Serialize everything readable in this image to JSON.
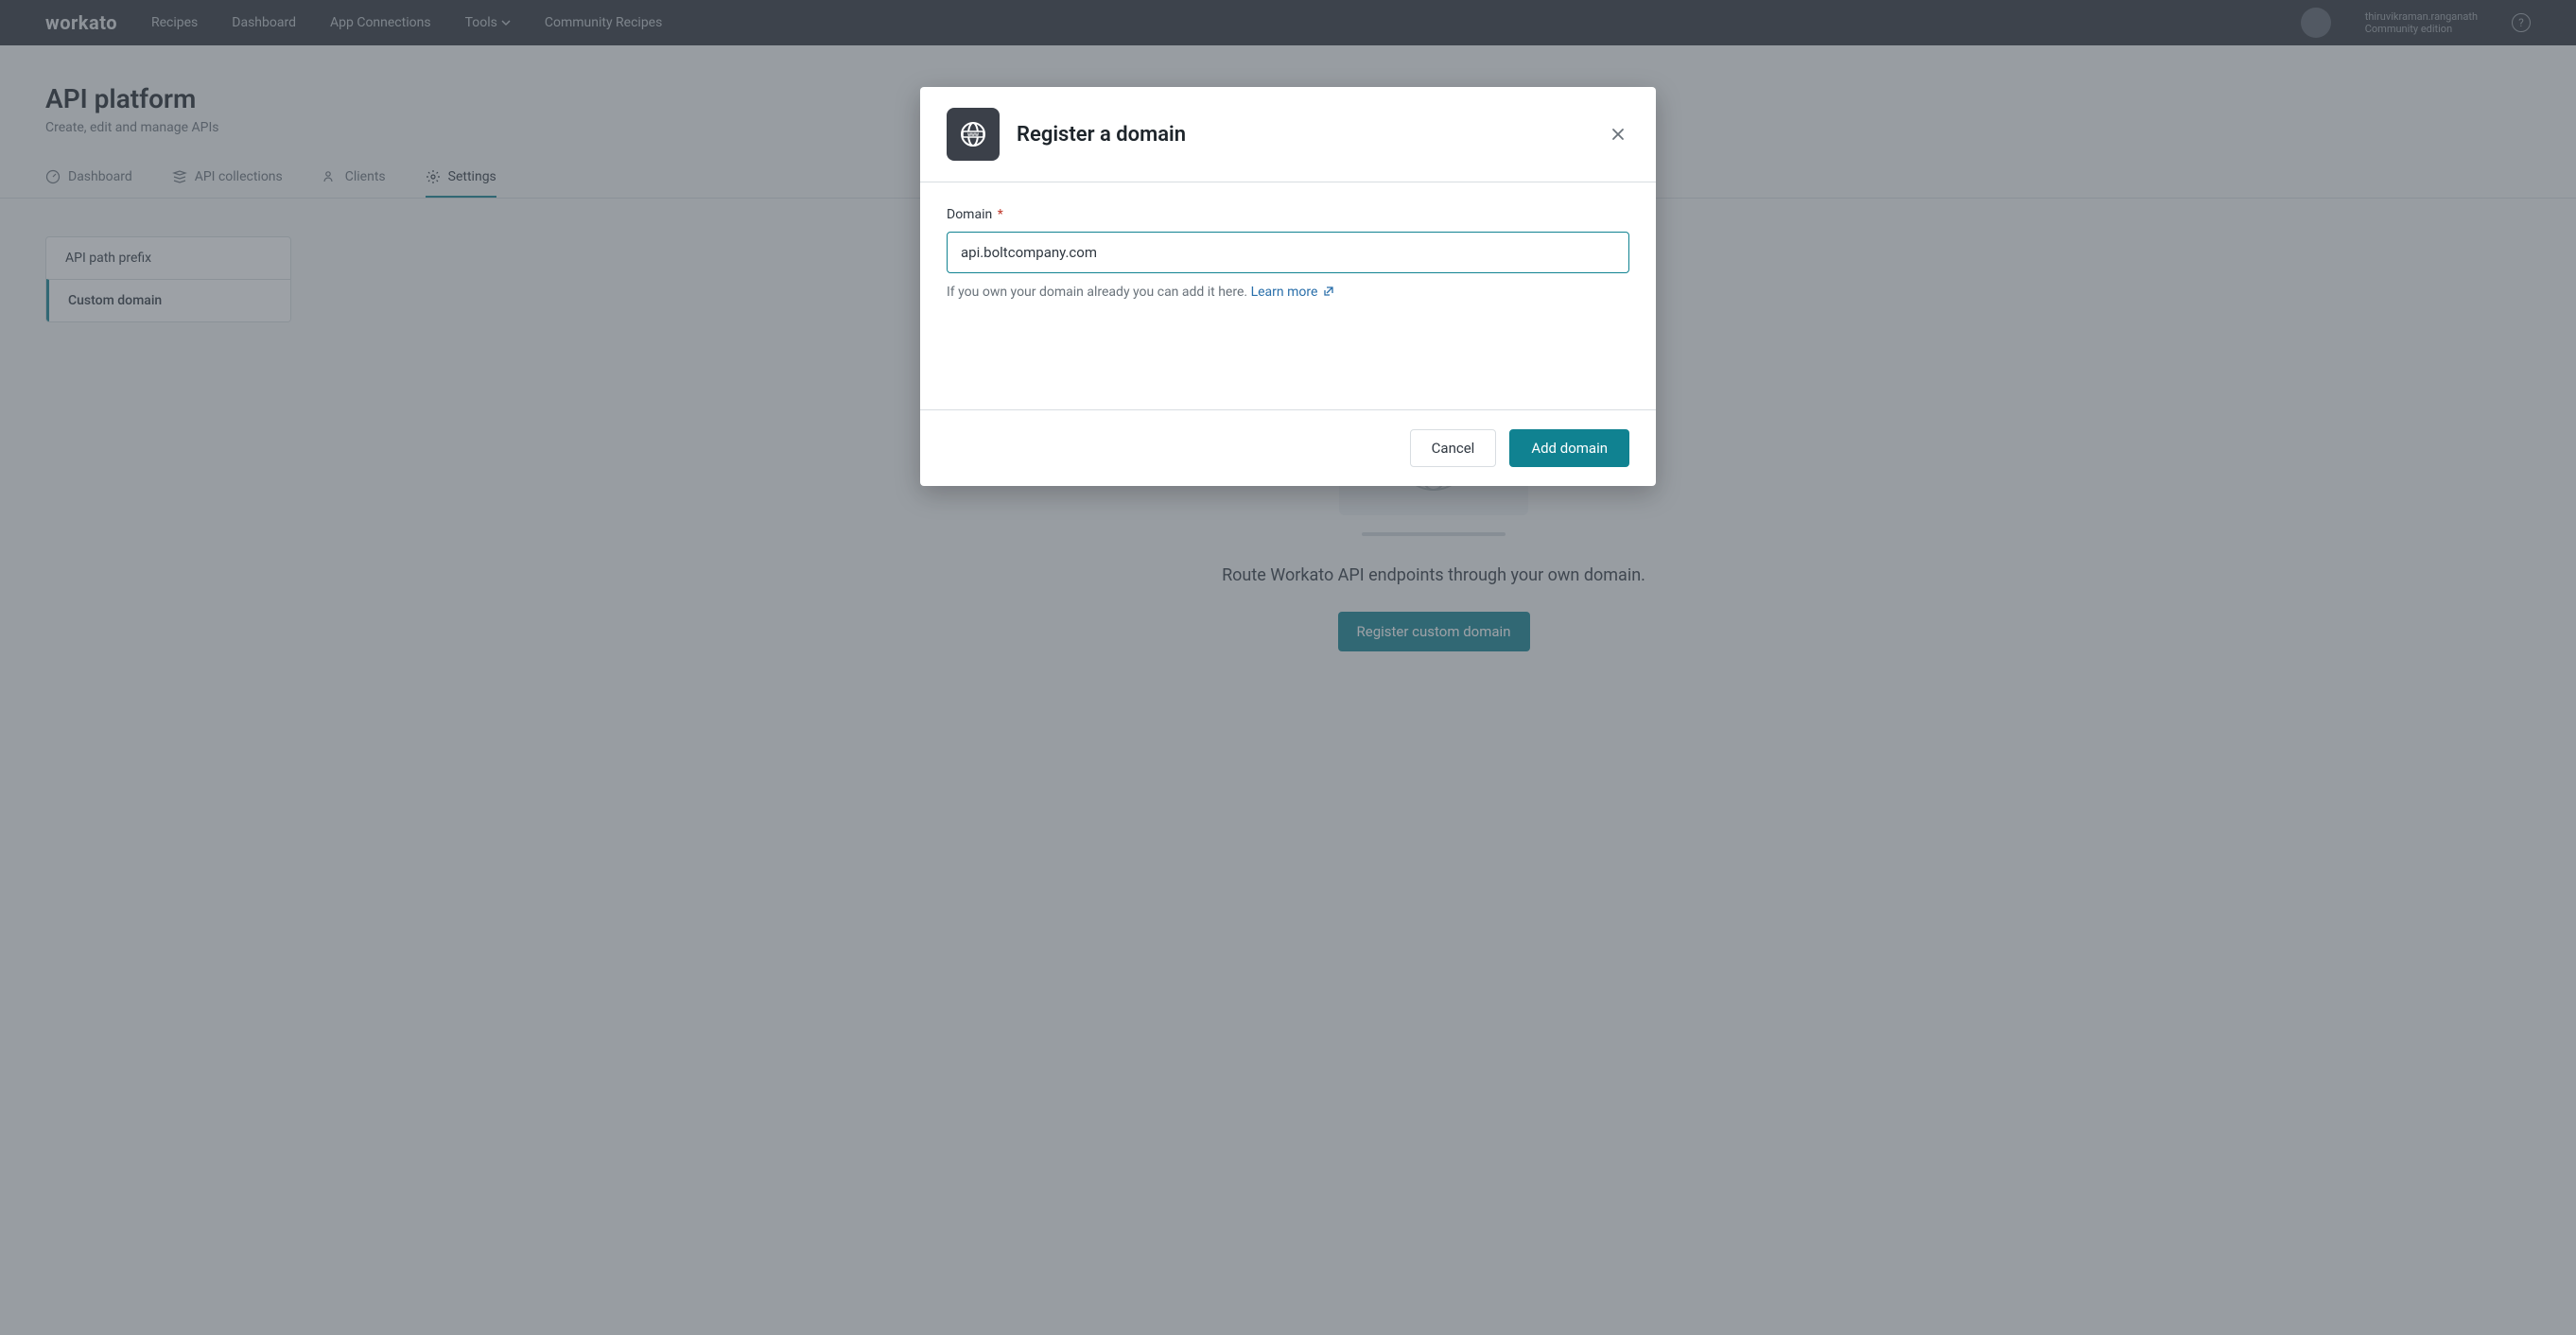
{
  "nav": {
    "logo": "workato",
    "items": [
      "Recipes",
      "Dashboard",
      "App Connections",
      "Tools",
      "Community Recipes"
    ],
    "account_line1": "thiruvikraman.ranganath",
    "account_line2": "Community edition"
  },
  "page": {
    "title": "API platform",
    "subtitle": "Create, edit and manage APIs"
  },
  "tabs": [
    {
      "id": "dashboard",
      "label": "Dashboard"
    },
    {
      "id": "collections",
      "label": "API collections"
    },
    {
      "id": "clients",
      "label": "Clients"
    },
    {
      "id": "settings",
      "label": "Settings"
    }
  ],
  "active_tab": "settings",
  "settings_side": {
    "items": [
      {
        "id": "prefix",
        "label": "API path prefix"
      },
      {
        "id": "domain",
        "label": "Custom domain"
      }
    ],
    "active": "domain"
  },
  "empty": {
    "line": "Route Workato API endpoints through your own domain.",
    "cta": "Register custom domain"
  },
  "modal": {
    "title": "Register a domain",
    "field_label": "Domain",
    "required_mark": "*",
    "value": "api.boltcompany.com",
    "help": "If you own your domain already you can add it here.",
    "learn_more": "Learn more",
    "cancel": "Cancel",
    "submit": "Add domain"
  }
}
